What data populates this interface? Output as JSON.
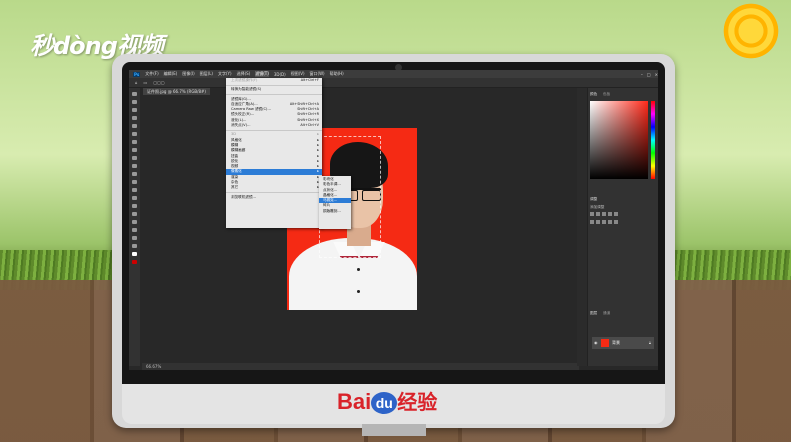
{
  "brand": {
    "logo_text": "秒dòng视频"
  },
  "footer": {
    "baidu_bai": "Bai",
    "baidu_du": "du",
    "baidu_cn": "经验"
  },
  "ps": {
    "menubar": [
      "文件(F)",
      "编辑(E)",
      "图像(I)",
      "图层(L)",
      "文字(Y)",
      "选择(S)",
      "滤镜(T)",
      "3D(D)",
      "视图(V)",
      "窗口(W)",
      "帮助(H)"
    ],
    "active_menu": "滤镜(T)",
    "doc_tab": "证件照.jpg @ 66.7% (RGB/8#)",
    "status": "66.67%",
    "filter_menu": {
      "last_filter": {
        "label": "上次滤镜操作(F)",
        "shortcut": "Alt+Ctrl+F"
      },
      "convert_smart": "转换为智能滤镜(S)",
      "gallery": [
        {
          "label": "滤镜库(G)...",
          "shortcut": ""
        },
        {
          "label": "自适应广角(A)...",
          "shortcut": "Alt+Shift+Ctrl+A"
        },
        {
          "label": "Camera Raw 滤镜(C)...",
          "shortcut": "Shift+Ctrl+A"
        },
        {
          "label": "镜头校正(R)...",
          "shortcut": "Shift+Ctrl+R"
        },
        {
          "label": "液化(L)...",
          "shortcut": "Shift+Ctrl+X"
        },
        {
          "label": "消失点(V)...",
          "shortcut": "Alt+Ctrl+V"
        }
      ],
      "categories": [
        "3D",
        "风格化",
        "模糊",
        "模糊画廊",
        "扭曲",
        "锐化",
        "视频",
        "像素化",
        "渲染",
        "杂色",
        "其它"
      ],
      "highlighted": "像素化",
      "browse": "浏览联机滤镜..."
    },
    "submenu": [
      "彩块化",
      "彩色半调...",
      "点状化...",
      "晶格化...",
      "马赛克...",
      "碎片",
      "铜版雕刻..."
    ],
    "submenu_highlighted": "马赛克...",
    "panels": {
      "color_tab": "颜色",
      "swatch_tab": "色板",
      "adjust_tab": "调整",
      "adjust_label": "添加调整",
      "layers_tab": "图层",
      "channels_tab": "通道",
      "layer_name": "背景"
    }
  }
}
